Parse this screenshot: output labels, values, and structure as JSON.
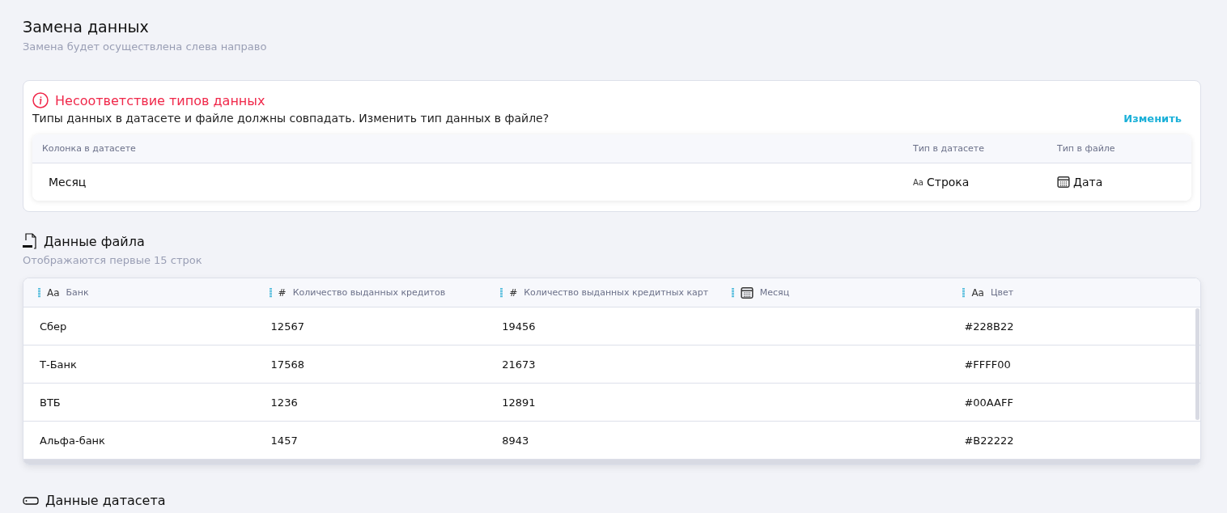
{
  "header": {
    "title": "Замена данных",
    "subtitle": "Замена будет осуществлена слева направо"
  },
  "mismatch": {
    "title": "Несоответствие типов данных",
    "message": "Типы данных в датасете и файле должны совпадать. Изменить тип данных в файле?",
    "action": "Изменить",
    "columns": [
      "Колонка в датасете",
      "Тип в датасете",
      "Тип в файле"
    ],
    "rows": [
      {
        "column": "Месяц",
        "dataset_type": {
          "kind": "text",
          "mark": "Aa",
          "label": "Строка"
        },
        "file_type": {
          "kind": "date",
          "label": "Дата"
        }
      }
    ]
  },
  "file_data": {
    "title": "Данные файла",
    "subtitle": "Отображаются первые 15 строк",
    "columns": [
      {
        "kind": "text",
        "mark": "Aa",
        "label": "Банк"
      },
      {
        "kind": "number",
        "mark": "#",
        "label": "Количество выданных кредитов"
      },
      {
        "kind": "number",
        "mark": "#",
        "label": "Количество выданных кредитных карт"
      },
      {
        "kind": "date",
        "label": "Месяц"
      },
      {
        "kind": "text",
        "mark": "Aa",
        "label": "Цвет"
      }
    ],
    "rows": [
      [
        "Сбер",
        "12567",
        "19456",
        "",
        "#228B22"
      ],
      [
        "Т-Банк",
        "17568",
        "21673",
        "",
        "#FFFF00"
      ],
      [
        "ВТБ",
        "1236",
        "12891",
        "",
        "#00AAFF"
      ],
      [
        "Альфа-банк",
        "1457",
        "8943",
        "",
        "#B22222"
      ]
    ]
  },
  "dataset_data": {
    "title": "Данные датасета"
  }
}
